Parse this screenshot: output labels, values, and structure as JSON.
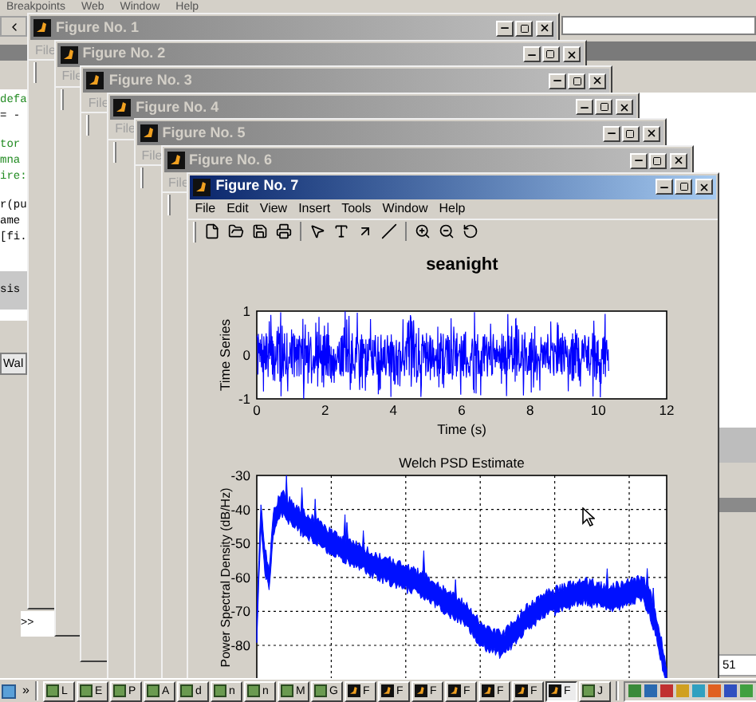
{
  "main_window": {
    "menu": [
      "Breakpoints",
      "Web",
      "Window",
      "Help"
    ],
    "editor_blocks": [
      [
        {
          "text": "defa",
          "kind": "comment"
        },
        {
          "text": "= -",
          "kind": "code"
        }
      ],
      [
        {
          "text": "tor",
          "kind": "comment"
        },
        {
          "text": "mna",
          "kind": "comment"
        },
        {
          "text": "ire:",
          "kind": "comment"
        }
      ],
      [
        {
          "text": "r(pu",
          "kind": "code"
        },
        {
          "text": "ame",
          "kind": "code"
        },
        {
          "text": "[fi.",
          "kind": "code"
        }
      ]
    ],
    "highlighted_line": "sis",
    "workspace_tab": "Wal",
    "command_prompt": ">>",
    "status_text": "51"
  },
  "figures": [
    {
      "title": "Figure No. 1",
      "active": false,
      "menu": [
        "File"
      ]
    },
    {
      "title": "Figure No. 2",
      "active": false,
      "menu": [
        "File"
      ]
    },
    {
      "title": "Figure No. 3",
      "active": false,
      "menu": [
        "File"
      ]
    },
    {
      "title": "Figure No. 4",
      "active": false,
      "menu": [
        "File"
      ]
    },
    {
      "title": "Figure No. 5",
      "active": false,
      "menu": [
        "File"
      ]
    },
    {
      "title": "Figure No. 6",
      "active": false,
      "menu": [
        "File"
      ]
    },
    {
      "title": "Figure No. 7",
      "active": true,
      "menu": [
        "File",
        "Edit",
        "View",
        "Insert",
        "Tools",
        "Window",
        "Help"
      ],
      "plot_title": "seanight",
      "time_axes": {
        "ylabel": "Time Series",
        "xlabel": "Time (s)",
        "yticks": [
          "1",
          "0",
          "-1"
        ],
        "xticks": [
          "0",
          "2",
          "4",
          "6",
          "8",
          "10",
          "12"
        ]
      },
      "psd_axes": {
        "title": "Welch PSD Estimate",
        "ylabel": "Power Spectral Density (dB/Hz)",
        "yticks": [
          "-30",
          "-40",
          "-50",
          "-60",
          "-70",
          "-80"
        ]
      }
    }
  ],
  "taskbar": {
    "overflow": "»",
    "items": [
      {
        "kind": "app",
        "label": "L",
        "selected": false
      },
      {
        "kind": "app",
        "label": "E",
        "selected": false
      },
      {
        "kind": "app",
        "label": "P",
        "selected": false
      },
      {
        "kind": "app",
        "label": "A",
        "selected": false
      },
      {
        "kind": "app",
        "label": "d",
        "selected": false
      },
      {
        "kind": "app",
        "label": "n",
        "selected": false
      },
      {
        "kind": "app",
        "label": "n",
        "selected": false
      },
      {
        "kind": "app",
        "label": "M",
        "selected": false
      },
      {
        "kind": "app",
        "label": "G",
        "selected": false
      },
      {
        "kind": "figure",
        "label": "F",
        "selected": false
      },
      {
        "kind": "figure",
        "label": "F",
        "selected": false
      },
      {
        "kind": "figure",
        "label": "F",
        "selected": false
      },
      {
        "kind": "figure",
        "label": "F",
        "selected": false
      },
      {
        "kind": "figure",
        "label": "F",
        "selected": false
      },
      {
        "kind": "figure",
        "label": "F",
        "selected": false
      },
      {
        "kind": "figure",
        "label": "F",
        "selected": true
      },
      {
        "kind": "app",
        "label": "J",
        "selected": false
      }
    ]
  }
}
